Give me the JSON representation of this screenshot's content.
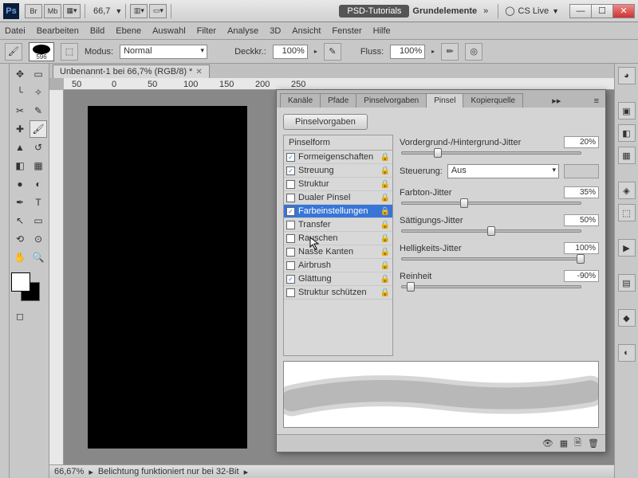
{
  "title": {
    "app": "Ps",
    "workspace1": "PSD-Tutorials",
    "workspace2": "Grundelemente",
    "cslive": "CS Live",
    "zoom": "66,7"
  },
  "menu": {
    "datei": "Datei",
    "bearbeiten": "Bearbeiten",
    "bild": "Bild",
    "ebene": "Ebene",
    "auswahl": "Auswahl",
    "filter": "Filter",
    "analyse": "Analyse",
    "dreid": "3D",
    "ansicht": "Ansicht",
    "fenster": "Fenster",
    "hilfe": "Hilfe"
  },
  "opt": {
    "brush_size": "596",
    "modus_label": "Modus:",
    "modus_value": "Normal",
    "deck_label": "Deckkr.:",
    "deck_value": "100%",
    "fluss_label": "Fluss:",
    "fluss_value": "100%"
  },
  "doc": {
    "tab": "Unbenannt-1 bei 66,7% (RGB/8) *"
  },
  "ruler": {
    "m50": "50",
    "p0": "0",
    "p50": "50",
    "p100": "100",
    "p150": "150",
    "p200": "200",
    "p250": "250"
  },
  "status": {
    "zoom": "66,67%",
    "msg": "Belichtung funktioniert nur bei 32-Bit"
  },
  "panel": {
    "tabs": {
      "kanale": "Kanäle",
      "pfade": "Pfade",
      "vorgaben": "Pinselvorgaben",
      "pinsel": "Pinsel",
      "kopier": "Kopierquelle"
    },
    "preset_btn": "Pinselvorgaben",
    "head": "Pinselform",
    "items": [
      {
        "label": "Formeigenschaften",
        "checked": true,
        "locked": true,
        "selected": false
      },
      {
        "label": "Streuung",
        "checked": true,
        "locked": true,
        "selected": false
      },
      {
        "label": "Struktur",
        "checked": false,
        "locked": true,
        "selected": false
      },
      {
        "label": "Dualer Pinsel",
        "checked": false,
        "locked": true,
        "selected": false
      },
      {
        "label": "Farbeinstellungen",
        "checked": true,
        "locked": true,
        "selected": true
      },
      {
        "label": "Transfer",
        "checked": false,
        "locked": true,
        "selected": false
      },
      {
        "label": "Rauschen",
        "checked": false,
        "locked": true,
        "selected": false
      },
      {
        "label": "Nasse Kanten",
        "checked": false,
        "locked": true,
        "selected": false
      },
      {
        "label": "Airbrush",
        "checked": false,
        "locked": true,
        "selected": false
      },
      {
        "label": "Glättung",
        "checked": true,
        "locked": true,
        "selected": false
      },
      {
        "label": "Struktur schützen",
        "checked": false,
        "locked": true,
        "selected": false
      }
    ],
    "sliders": {
      "fg_bg": {
        "label": "Vordergrund-/Hintergrund-Jitter",
        "value": "20%",
        "pos": 20
      },
      "steuerung": {
        "label": "Steuerung:",
        "value": "Aus"
      },
      "farbton": {
        "label": "Farbton-Jitter",
        "value": "35%",
        "pos": 35
      },
      "saettigung": {
        "label": "Sättigungs-Jitter",
        "value": "50%",
        "pos": 50
      },
      "helligkeit": {
        "label": "Helligkeits-Jitter",
        "value": "100%",
        "pos": 100
      },
      "reinheit": {
        "label": "Reinheit",
        "value": "-90%",
        "pos": 5
      }
    }
  },
  "tb_btns": {
    "br": "Br",
    "mb": "Mb"
  }
}
